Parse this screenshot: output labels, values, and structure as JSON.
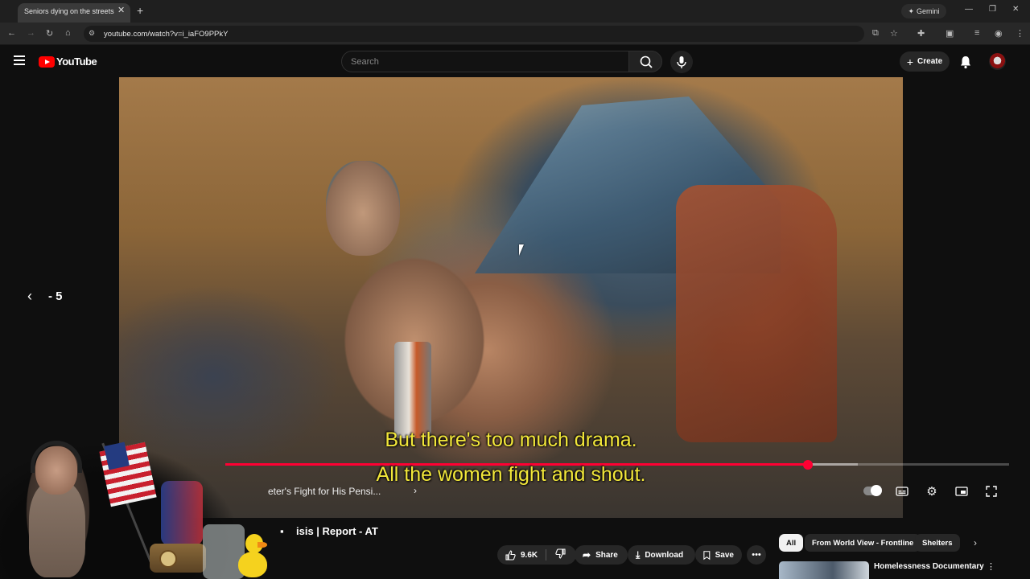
{
  "browser": {
    "tab_title": "Seniors dying on the streets: U",
    "url": "youtube.com/watch?v=i_iaFO9PPkY",
    "gemini_label": "Gemini"
  },
  "youtube": {
    "logo_text": "YouTube",
    "search_placeholder": "Search",
    "create_label": "Create"
  },
  "player": {
    "subtitle_line1": "But there's too much drama.",
    "subtitle_line2": "All the women fight and shout.",
    "chapter_title": "eter's Fight for His Pensi...",
    "seek_label": "- 5",
    "progress_fraction": 0.743,
    "buffered_fraction": 0.807,
    "progress_color": "#ff0033"
  },
  "video": {
    "title": "isis | Report - AT",
    "title_prefix": "▪"
  },
  "actions": {
    "like_count": "9.6K",
    "share_label": "Share",
    "download_label": "Download",
    "save_label": "Save"
  },
  "chips": [
    "All",
    "From World View - Frontline",
    "Shelters"
  ],
  "recommendations": [
    {
      "title": "Homelessness Documentary"
    }
  ]
}
